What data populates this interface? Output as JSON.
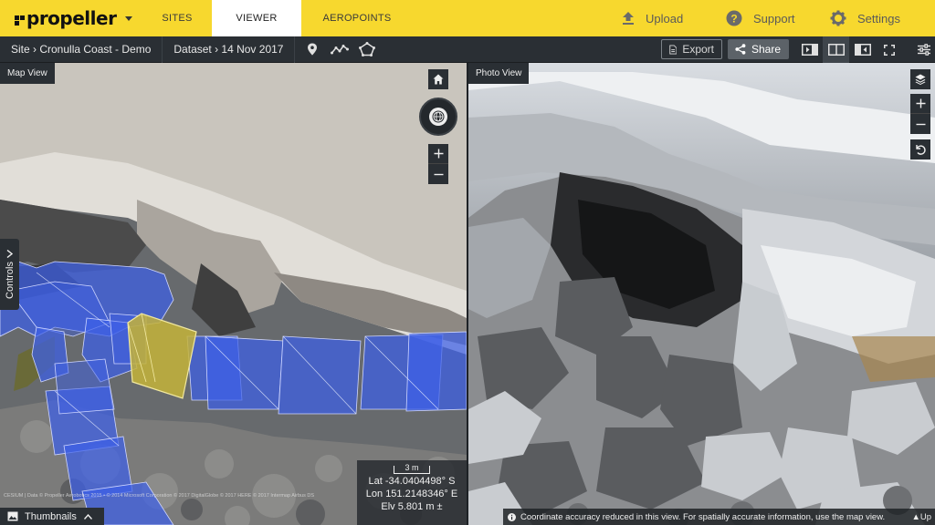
{
  "app": {
    "logo_text": "propeller"
  },
  "nav": {
    "tabs": [
      "SITES",
      "VIEWER",
      "AEROPOINTS"
    ],
    "active": "VIEWER"
  },
  "actions": {
    "upload": "Upload",
    "support": "Support",
    "settings": "Settings"
  },
  "breadcrumb": {
    "site": "Site › Cronulla Coast - Demo",
    "dataset": "Dataset › 14 Nov 2017"
  },
  "toolbar": {
    "export_label": "Export",
    "share_label": "Share"
  },
  "map_view": {
    "label": "Map View",
    "controls_label": "Controls",
    "scale_label": "3 m",
    "lat": "Lat -34.0404498° S",
    "lon": "Lon 151.2148346° E",
    "elv": "Elv 5.801 m ±",
    "attribution": "CESIUM | Data © Propeller Aerobotics 2015 • © 2014 Microsoft Corporation © 2017 DigitalGlobe © 2017 HERE © 2017 Intermap Airbus DS",
    "thumbnails_label": "Thumbnails"
  },
  "photo_view": {
    "label": "Photo View",
    "notice": "Coordinate accuracy reduced in this view. For spatially accurate information, use the map view.",
    "up_label": "▲Up"
  },
  "colors": {
    "brand_yellow": "#f7d82e",
    "toolbar_dark": "#2a2f34",
    "overlay_blue": "#3d5fe8",
    "overlay_selected": "#d8c43a"
  }
}
